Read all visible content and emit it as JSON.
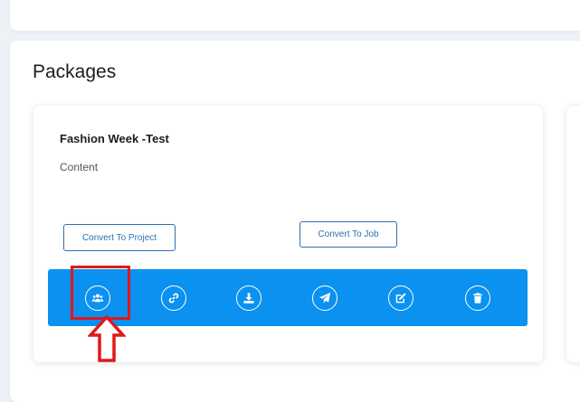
{
  "section": {
    "title": "Packages"
  },
  "package": {
    "title": "Fashion Week -Test",
    "content": "Content",
    "convert_project_label": "Convert To Project",
    "convert_job_label": "Convert To Job"
  },
  "actions": [
    {
      "icon": "users-icon"
    },
    {
      "icon": "link-icon"
    },
    {
      "icon": "download-icon"
    },
    {
      "icon": "send-icon"
    },
    {
      "icon": "edit-icon"
    },
    {
      "icon": "trash-icon"
    }
  ],
  "colors": {
    "accent": "#0b91f0",
    "outline": "#2f6fb3",
    "highlight": "#e01818",
    "background": "#eef1f6"
  }
}
